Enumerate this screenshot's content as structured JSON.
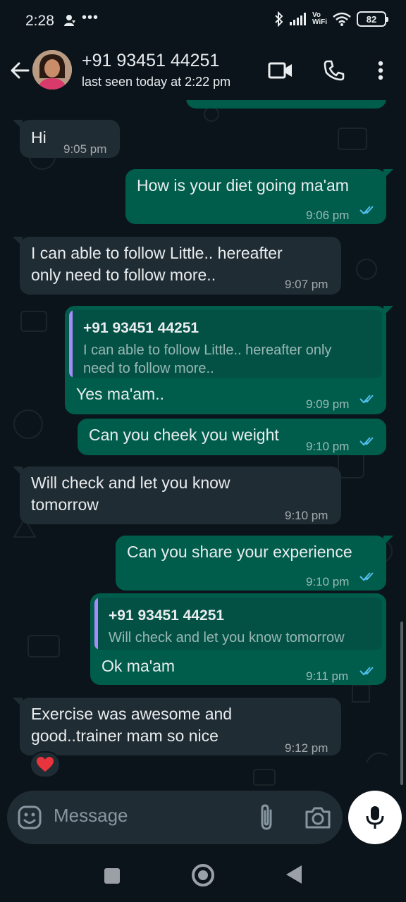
{
  "status_bar": {
    "time": "2:28",
    "dots": "•••",
    "vo_line1": "Vo",
    "vo_line2": "WiFi",
    "battery": "82",
    "icons": [
      "notification-person-icon",
      "bluetooth-icon",
      "signal-icon",
      "wifi-icon",
      "battery-icon"
    ]
  },
  "header": {
    "contact_name": "+91 93451 44251",
    "contact_status": "last seen today at 2:22 pm",
    "icons": [
      "back-arrow-icon",
      "video-call-icon",
      "voice-call-icon",
      "more-vert-icon"
    ]
  },
  "messages": [
    {
      "direction": "in",
      "text": "Hi",
      "time": "9:05 pm"
    },
    {
      "direction": "out",
      "text": "How is your diet going ma'am",
      "time": "9:06 pm",
      "read": true
    },
    {
      "direction": "in",
      "lines": [
        "I can able to follow Little.. hereafter",
        "only need to follow more.."
      ],
      "time": "9:07 pm"
    },
    {
      "direction": "out",
      "quote": {
        "name": "+91 93451 44251",
        "lines": [
          "I can able to follow Little.. hereafter only",
          "need to follow more.."
        ]
      },
      "text": "Yes ma'am..",
      "time": "9:09 pm",
      "read": true
    },
    {
      "direction": "out",
      "text": "Can you cheek you weight",
      "time": "9:10 pm",
      "read": true
    },
    {
      "direction": "in",
      "lines": [
        "Will check and let you know",
        "tomorrow"
      ],
      "time": "9:10 pm"
    },
    {
      "direction": "out",
      "text": "Can you share your experience",
      "time": "9:10 pm",
      "read": true
    },
    {
      "direction": "out",
      "quote": {
        "name": "+91 93451 44251",
        "lines": [
          "Will check and let you know tomorrow"
        ]
      },
      "text": "Ok ma'am",
      "time": "9:11 pm",
      "read": true
    },
    {
      "direction": "in",
      "lines": [
        "Exercise was awesome and",
        "good..trainer mam so nice"
      ],
      "time": "9:12 pm",
      "reaction": "heart"
    }
  ],
  "input": {
    "placeholder": "Message",
    "icons": [
      "emoji-icon",
      "attach-icon",
      "camera-icon",
      "mic-icon"
    ]
  },
  "colors": {
    "background": "#0b141a",
    "incoming_bubble": "#202c33",
    "outgoing_bubble": "#005c4b",
    "read_ticks": "#53bdeb",
    "quote_bar": "#a78bfa"
  }
}
